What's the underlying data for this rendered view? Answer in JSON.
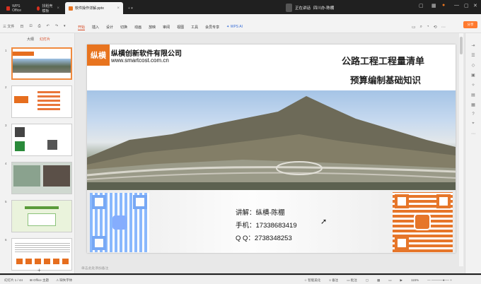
{
  "tabs": [
    {
      "label": "WPS Office",
      "color": "#d6301f"
    },
    {
      "label": "找稻壳模板",
      "color": "#d6301f"
    },
    {
      "label": "软件操作详解.pptx",
      "color": "#e8741f"
    }
  ],
  "meeting": {
    "status": "正在讲话",
    "speaker": "四川办-陈棚"
  },
  "menu_left": [
    "三 文件",
    "日",
    "⊡",
    "⎙",
    "↶",
    "↷",
    "▾"
  ],
  "menu_items": [
    "开始",
    "插入",
    "设计",
    "切换",
    "动画",
    "放映",
    "审阅",
    "视图",
    "工具",
    "会员专享"
  ],
  "wps_ai": "WPS AI",
  "share_label": "分享",
  "side_tabs": [
    "大纲",
    "幻灯片"
  ],
  "thumb_numbers": [
    "1",
    "2",
    "3",
    "4",
    "5",
    "6"
  ],
  "slide": {
    "logo": "纵横",
    "company": "纵横创新软件有限公司",
    "website": "www.smartcost.com.cn",
    "title_line1": "公路工程工程量清单",
    "title_line2": "预算编制基础知识",
    "speaker_line": "讲解：纵横-陈棚",
    "phone_line": "手机：17338683419",
    "qq_line": "Q  Q：2738348253"
  },
  "notes_placeholder": "单击此处添加备注",
  "status": {
    "slide_counter": "幻灯片 1 / 44",
    "theme": "Office 主题",
    "font": "缺失字体",
    "smart_beautify": "智能美化",
    "notes": "备注",
    "comments": "批注",
    "zoom": "115%"
  },
  "colors": {
    "accent": "#d6461f",
    "brand_orange": "#e8741f"
  }
}
